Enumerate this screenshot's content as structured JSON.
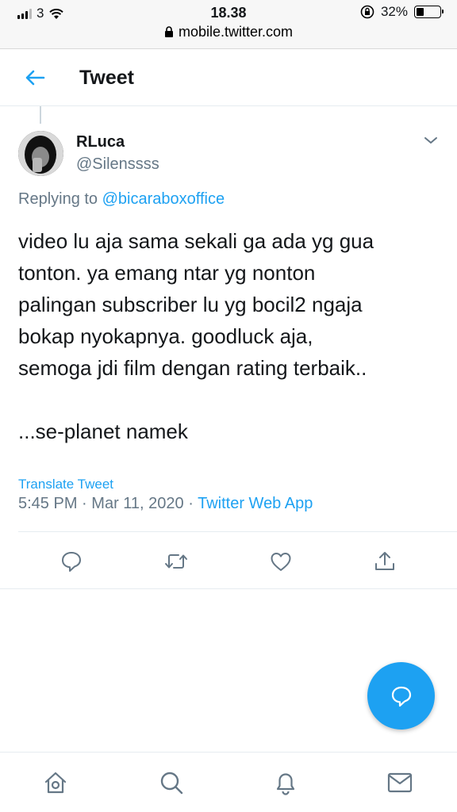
{
  "status_bar": {
    "carrier": "3",
    "time": "18.38",
    "battery_percent": "32%",
    "battery_level": 0.32,
    "url": "mobile.twitter.com"
  },
  "header": {
    "title": "Tweet"
  },
  "tweet": {
    "author_name": "RLuca",
    "author_handle": "@Silenssss",
    "replying_prefix": "Replying to ",
    "replying_to": "@bicaraboxoffice",
    "lines": [
      "video lu aja sama sekali ga ada yg gua",
      "tonton. ya emang ntar yg nonton",
      "palingan subscriber lu yg bocil2 ngaja",
      "bokap nyokapnya. goodluck aja,",
      "semoga jdi film dengan rating terbaik.."
    ],
    "last_line": "...se-planet namek",
    "translate_label": "Translate Tweet",
    "time": "5:45 PM",
    "date": "Mar 11, 2020",
    "separator": "·",
    "source": "Twitter Web App"
  },
  "actions": [
    "reply-icon",
    "retweet-icon",
    "like-icon",
    "share-icon"
  ],
  "bottom_nav": [
    "home-icon",
    "search-icon",
    "notifications-icon",
    "messages-icon"
  ],
  "colors": {
    "accent": "#1da1f2",
    "text_primary": "#14171a",
    "text_secondary": "#657786",
    "icon_gray": "#657786"
  }
}
